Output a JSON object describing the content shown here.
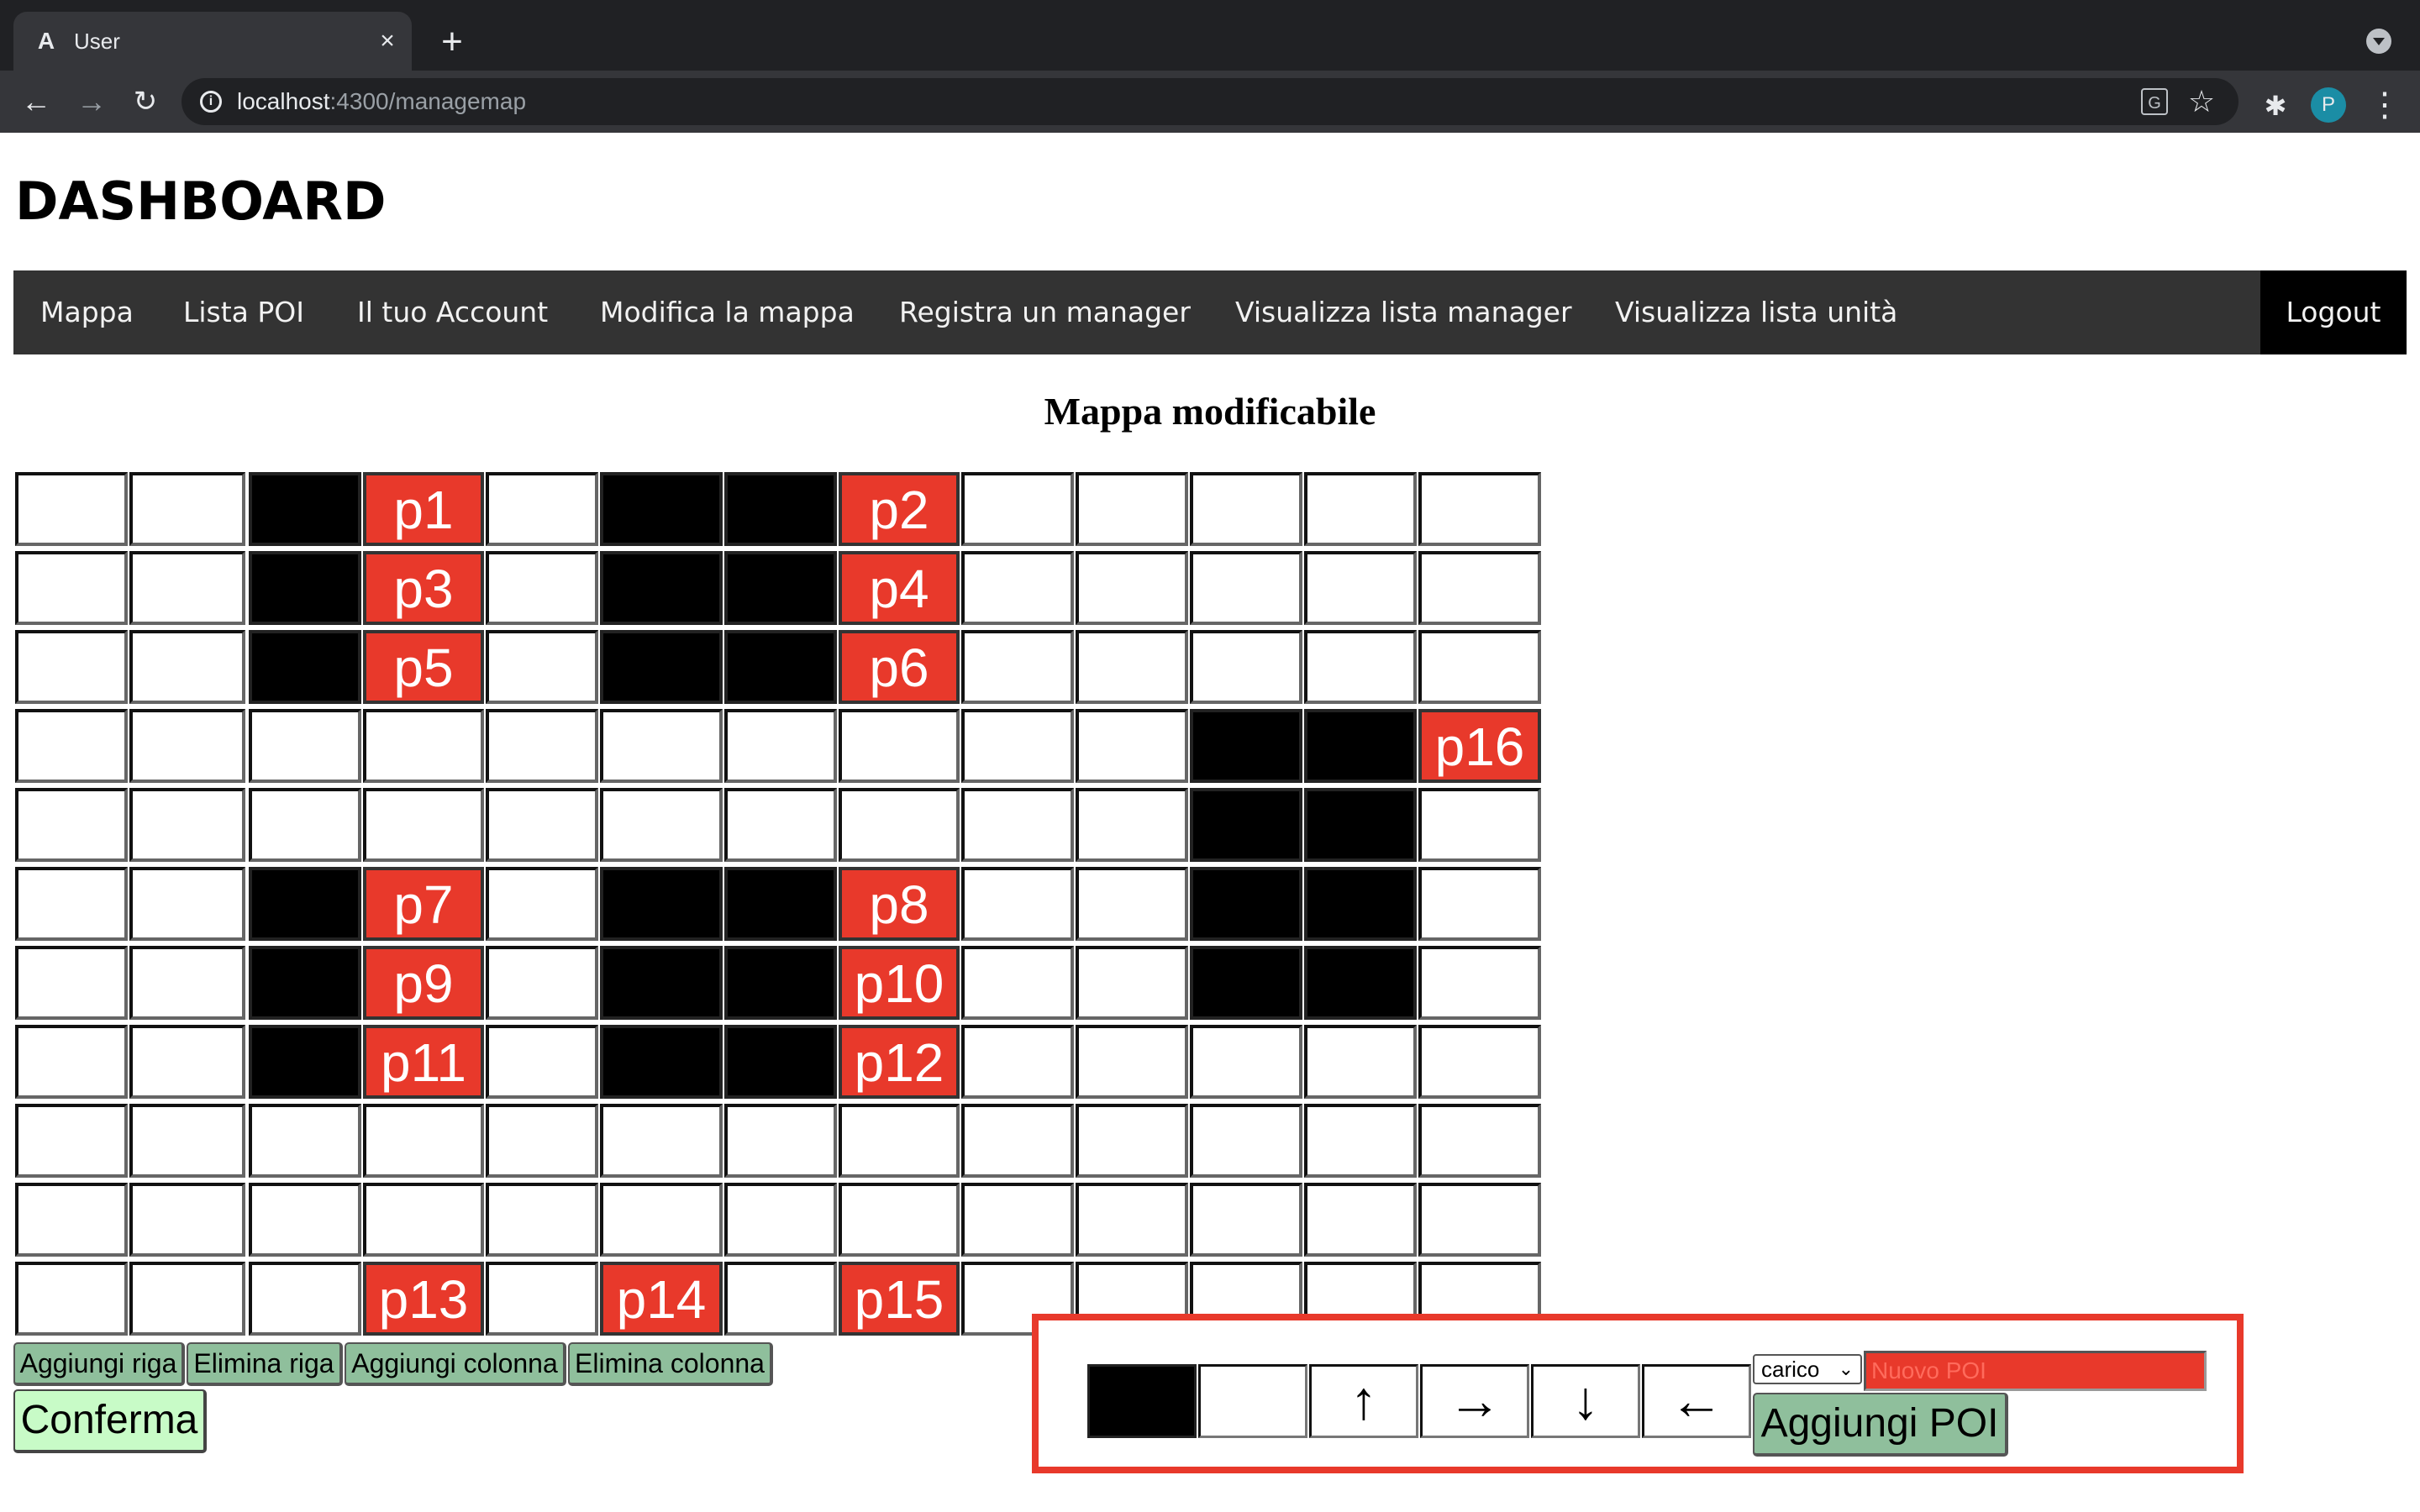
{
  "browser": {
    "tab_title": "User",
    "tab_favicon": "A",
    "url_host": "localhost",
    "url_path": ":4300/managemap",
    "profile_initial": "P"
  },
  "page": {
    "title": "DASHBOARD",
    "map_title": "Mappa modificabile"
  },
  "nav": {
    "items": [
      "Mappa",
      "Lista POI",
      "Il tuo Account",
      "Modifica la mappa",
      "Registra un manager",
      "Visualizza lista manager",
      "Visualizza lista unità"
    ],
    "logout": "Logout"
  },
  "grid": {
    "rows": 11,
    "cols": 13,
    "legend": {
      ".": "empty",
      "#": "wall",
      "P": "poi"
    },
    "layout": [
      "..#P.##P.....",
      "..#P.##P.....",
      "..#P.##P.....",
      "..........##P",
      "..........##.",
      "..#P.##P..##.",
      "..#P.##P..##.",
      "..#P.##P.....",
      ".............",
      ".............",
      "...P.P.P....."
    ],
    "poi_labels": [
      "p1",
      "p2",
      "p3",
      "p4",
      "p5",
      "p6",
      "p16",
      "p7",
      "p8",
      "p9",
      "p10",
      "p11",
      "p12",
      "p13",
      "p14",
      "p15"
    ]
  },
  "controls": {
    "add_row": "Aggiungi riga",
    "delete_row": "Elimina riga",
    "add_column": "Aggiungi colonna",
    "delete_column": "Elimina colonna",
    "confirm": "Conferma"
  },
  "tools": {
    "up": "↑",
    "right": "→",
    "down": "↓",
    "left": "←",
    "type_selected": "carico",
    "poi_placeholder": "Nuovo POI",
    "add_poi": "Aggiungi POI"
  },
  "colors": {
    "poi": "#e8392b",
    "wall": "#000000",
    "navbar": "#333333",
    "button": "#8fbf9c",
    "confirm": "#c8fbc7",
    "highlight": "#e8392b"
  }
}
